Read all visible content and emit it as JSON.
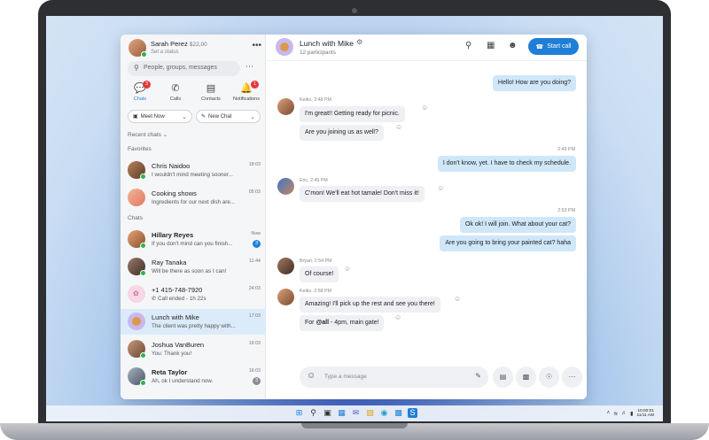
{
  "profile": {
    "name": "Sarah Perez",
    "credit": "$22,00",
    "status": "Set a status",
    "more_label": "•••"
  },
  "search": {
    "placeholder": "People, groups, messages"
  },
  "nav": [
    {
      "label": "Chats",
      "icon": "chat-icon",
      "badge": "3",
      "active": true
    },
    {
      "label": "Calls",
      "icon": "phone-icon",
      "badge": ""
    },
    {
      "label": "Contacts",
      "icon": "contacts-icon",
      "badge": ""
    },
    {
      "label": "Notifications",
      "icon": "bell-icon",
      "badge": "1"
    }
  ],
  "actions": {
    "meet_now": "Meet Now",
    "new_chat": "New Chat"
  },
  "sections": {
    "recent": "Recent chats",
    "favorites": "Favorites",
    "chats": "Chats"
  },
  "favorites": [
    {
      "name": "Chris Naidoo",
      "preview": "I wouldn't mind meeting sooner...",
      "time": "18:03"
    },
    {
      "name": "Cooking shows",
      "preview": "Ingredients for our next dish are...",
      "time": "05:03"
    }
  ],
  "chats": [
    {
      "name": "Hillary Reyes",
      "preview": "If you don't mind can you finish...",
      "time": "Now",
      "count": "3",
      "bold": true
    },
    {
      "name": "Ray Tanaka",
      "preview": "Will be there as soon as I can!",
      "time": "11:44"
    },
    {
      "name": "+1 415-748-7920",
      "preview": "Call ended - 1h 22s",
      "time": "24:03"
    },
    {
      "name": "Lunch with Mike",
      "preview": "The client was pretty happy with...",
      "time": "17:03",
      "active": true
    },
    {
      "name": "Joshua VanBuren",
      "preview": "You: Thank you!",
      "time": "16:03"
    },
    {
      "name": "Reta Taylor",
      "preview": "Ah, ok I understand now.",
      "time": "16:03",
      "count": "3",
      "bold": true
    }
  ],
  "conversation": {
    "title": "Lunch with Mike",
    "participants": "12 participants",
    "start_call": "Start call",
    "composer_placeholder": "Type a message",
    "messages": [
      {
        "dir": "out",
        "text": "Hello! How are you doing?"
      },
      {
        "dir": "in",
        "sender_meta": "Keiko, 2:48 PM",
        "text": "I'm great!! Getting ready for picnic."
      },
      {
        "dir": "in",
        "text": "Are you joining us as well?"
      },
      {
        "dir": "out",
        "time": "2:49 PM",
        "text": "I don't know, yet. I have to check my schedule."
      },
      {
        "dir": "in",
        "sender_meta": "Eric, 2:49 PM",
        "text": "C'mon! We'll eat hot tamale! Don't miss it!"
      },
      {
        "dir": "out",
        "time": "2:53 PM",
        "text": "Ok ok! I will join. What about your cat?"
      },
      {
        "dir": "out",
        "text": "Are you going to bring your painted cat? haha"
      },
      {
        "dir": "in",
        "sender_meta": "Bryan, 2:54 PM",
        "text": "Of course!"
      },
      {
        "dir": "in",
        "sender_meta": "Keiko, 2:58 PM",
        "text": "Amazing! I'll pick up the rest and see you there!"
      },
      {
        "dir": "in",
        "mention": "@all",
        "text": "For @all - 4pm, main gate!",
        "text_after": " - 4pm, main gate!",
        "text_before": "For "
      }
    ]
  },
  "taskbar": {
    "clock_time": "10:00:01",
    "clock_date": "11/11 AM"
  },
  "colors": {
    "accent": "#1f7fd6",
    "outgoing_bubble": "#cfe7f8",
    "incoming_bubble": "#eef0f3",
    "badge_red": "#e4363c",
    "presence": "#2fb34a"
  }
}
